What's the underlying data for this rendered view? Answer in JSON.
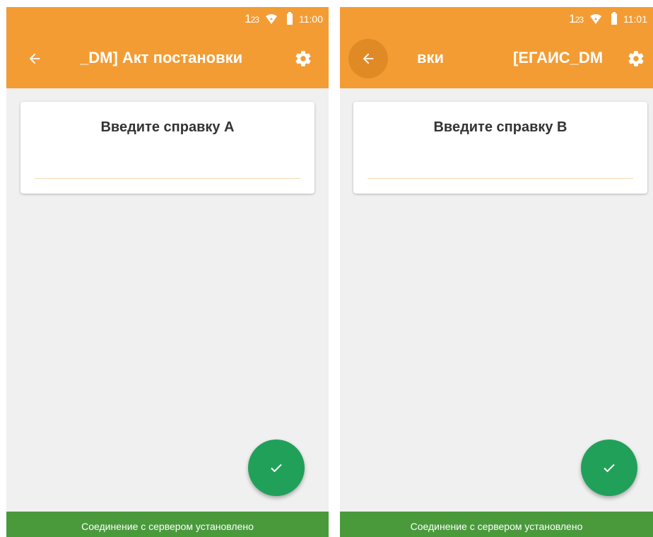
{
  "screens": [
    {
      "status": {
        "sim_label": "1",
        "sim_sub": "23",
        "time": "11:00"
      },
      "toolbar": {
        "title": "_DM] Акт постановки"
      },
      "card": {
        "title": "Введите справку А",
        "input_value": ""
      },
      "footer": {
        "text": "Соединение с сервером установлено"
      }
    },
    {
      "status": {
        "sim_label": "1",
        "sim_sub": "23",
        "time": "11:01"
      },
      "toolbar": {
        "title_part1": "вки",
        "title_part2": "[ЕГАИС_DM] Акт постановки"
      },
      "card": {
        "title": "Введите справку B",
        "input_value": ""
      },
      "footer": {
        "text": "Соединение с сервером установлено"
      }
    }
  ],
  "icons": [
    "arrow-back-icon",
    "settings-gear-icon",
    "check-icon",
    "signal-icon",
    "battery-icon"
  ],
  "colors": {
    "accent": "#f39c34",
    "fab": "#21a05a",
    "footer": "#4a9a3c"
  }
}
